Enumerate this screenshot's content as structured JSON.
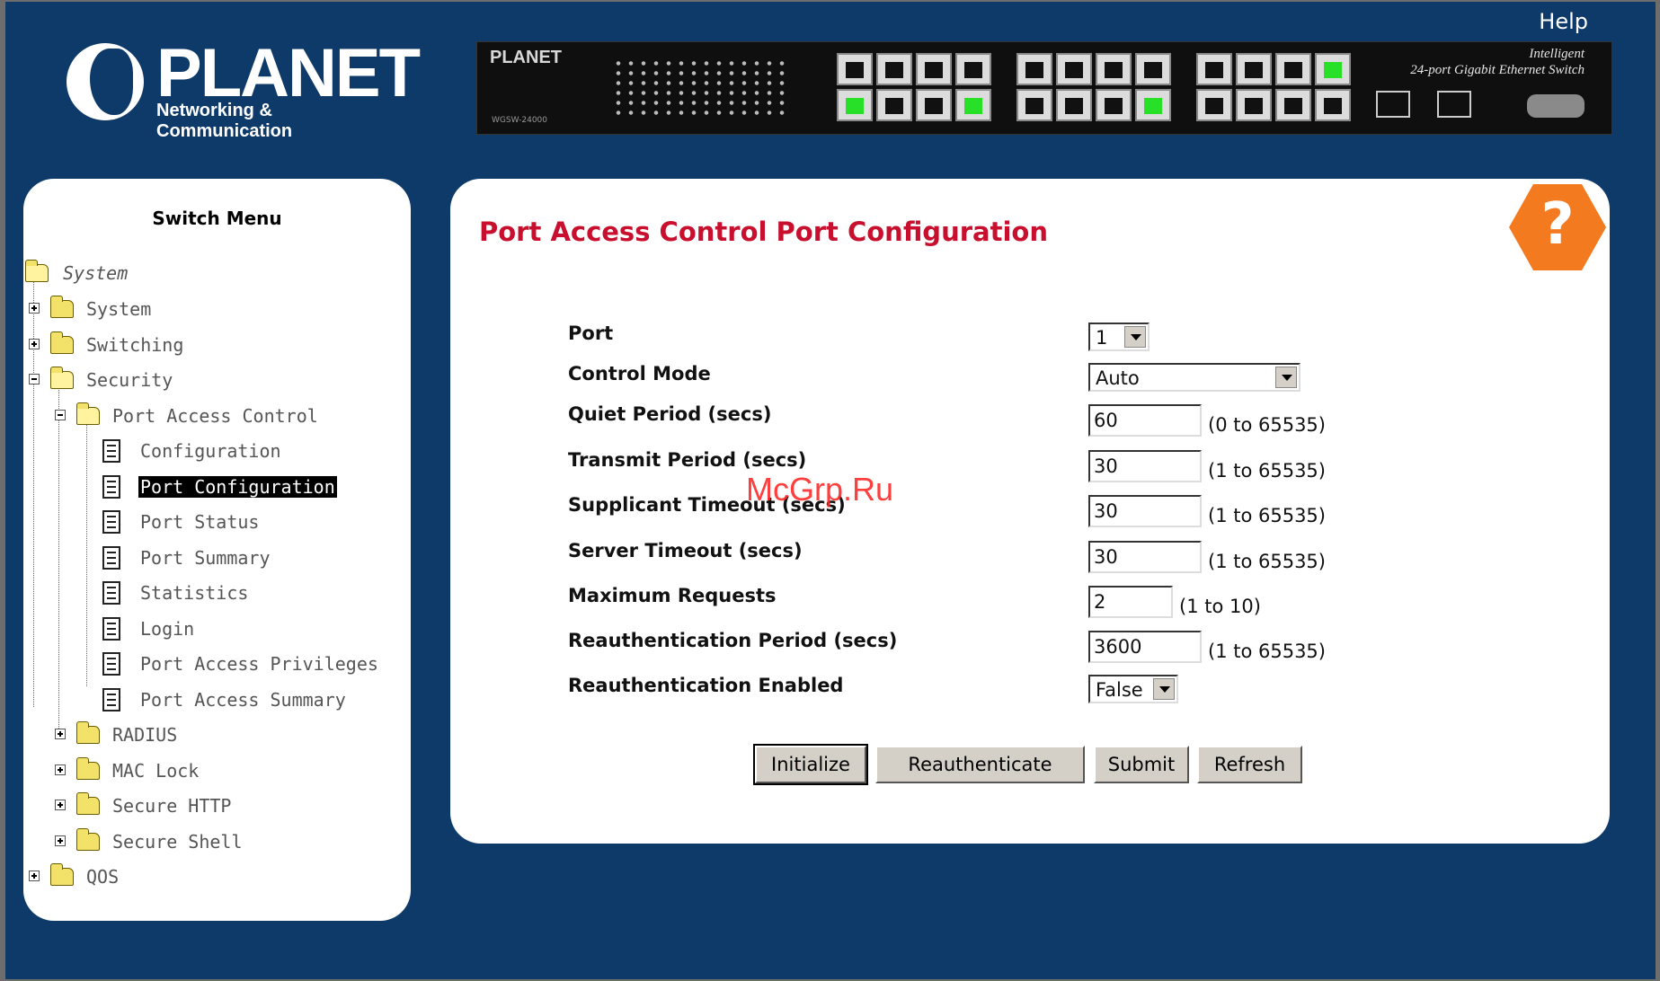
{
  "header": {
    "help_link": "Help",
    "logo_word": "PLANET",
    "logo_sub": "Networking & Communication",
    "switch_brand": "PLANET",
    "switch_model": "WGSW-24000",
    "switch_title_line1": "Intelligent",
    "switch_title_line2": "24-port Gigabit Ethernet Switch"
  },
  "menu": {
    "title": "Switch Menu",
    "items": [
      {
        "label": "System",
        "kind": "root"
      },
      {
        "label": "System",
        "kind": "folder"
      },
      {
        "label": "Switching",
        "kind": "folder"
      },
      {
        "label": "Security",
        "kind": "folder-open"
      },
      {
        "label": "Port Access Control",
        "kind": "folder-open"
      },
      {
        "label": "Configuration",
        "kind": "doc"
      },
      {
        "label": "Port Configuration",
        "kind": "doc",
        "selected": true
      },
      {
        "label": "Port Status",
        "kind": "doc"
      },
      {
        "label": "Port Summary",
        "kind": "doc"
      },
      {
        "label": "Statistics",
        "kind": "doc"
      },
      {
        "label": "Login",
        "kind": "doc"
      },
      {
        "label": "Port Access Privileges",
        "kind": "doc"
      },
      {
        "label": "Port Access Summary",
        "kind": "doc"
      },
      {
        "label": "RADIUS",
        "kind": "folder"
      },
      {
        "label": "MAC Lock",
        "kind": "folder"
      },
      {
        "label": "Secure HTTP",
        "kind": "folder"
      },
      {
        "label": "Secure Shell",
        "kind": "folder"
      },
      {
        "label": "QOS",
        "kind": "folder"
      }
    ]
  },
  "content": {
    "title": "Port Access Control Port Configuration",
    "help_badge": "?",
    "fields": {
      "port": {
        "label": "Port",
        "value": "1"
      },
      "control_mode": {
        "label": "Control Mode",
        "value": "Auto"
      },
      "quiet_period": {
        "label": "Quiet Period (secs)",
        "value": "60",
        "range": "(0 to 65535)"
      },
      "transmit_period": {
        "label": "Transmit Period (secs)",
        "value": "30",
        "range": "(1 to 65535)"
      },
      "supplicant_timeout": {
        "label": "Supplicant Timeout (secs)",
        "value": "30",
        "range": "(1 to 65535)"
      },
      "server_timeout": {
        "label": "Server Timeout (secs)",
        "value": "30",
        "range": "(1 to 65535)"
      },
      "max_requests": {
        "label": "Maximum Requests",
        "value": "2",
        "range": "(1 to 10)"
      },
      "reauth_period": {
        "label": "Reauthentication Period (secs)",
        "value": "3600",
        "range": "(1 to 65535)"
      },
      "reauth_enabled": {
        "label": "Reauthentication Enabled",
        "value": "False"
      }
    },
    "buttons": {
      "initialize": "Initialize",
      "reauthenticate": "Reauthenticate",
      "submit": "Submit",
      "refresh": "Refresh"
    }
  },
  "watermark": "McGrp.Ru",
  "colors": {
    "background": "#0e3a6a",
    "title_red": "#c8102e",
    "help_badge": "#f47a20",
    "port_link": "#27e027"
  }
}
